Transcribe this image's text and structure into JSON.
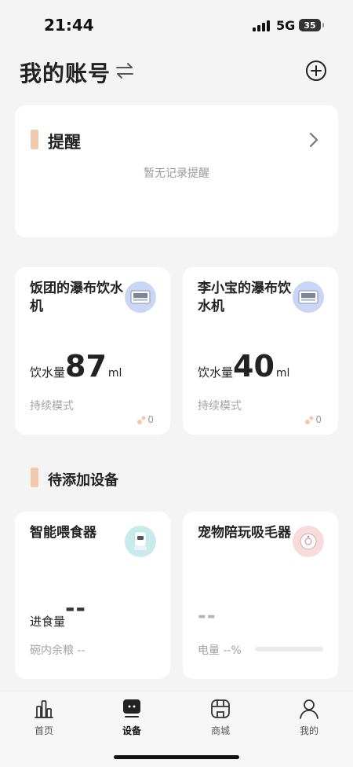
{
  "status_bar": {
    "time": "21:44",
    "network": "5G",
    "battery": "35"
  },
  "header": {
    "title": "我的账号"
  },
  "reminder": {
    "title": "提醒",
    "empty_text": "暂无记录提醒"
  },
  "devices": [
    {
      "name": "饭团的瀑布饮水机",
      "metric_label": "饮水量",
      "value": "87",
      "unit": "ml",
      "mode": "持续模式",
      "count": "0"
    },
    {
      "name": "李小宝的瀑布饮水机",
      "metric_label": "饮水量",
      "value": "40",
      "unit": "ml",
      "mode": "持续模式",
      "count": "0"
    }
  ],
  "pending": {
    "title": "待添加设备",
    "items": [
      {
        "name": "智能喂食器",
        "metric_label": "进食量",
        "value": "--",
        "bowl_label": "碗内余粮 --"
      },
      {
        "name": "宠物陪玩吸毛器",
        "value": "--",
        "power_label": "电量 --%"
      }
    ]
  },
  "nav": {
    "items": [
      {
        "label": "首页",
        "icon": "chart-icon"
      },
      {
        "label": "设备",
        "icon": "device-icon",
        "active": true
      },
      {
        "label": "商城",
        "icon": "store-icon"
      },
      {
        "label": "我的",
        "icon": "person-icon"
      }
    ]
  },
  "colors": {
    "accent": "#f2c9ad",
    "background": "#f4f4f5",
    "card": "#ffffff",
    "muted_text": "#a3a3a3"
  }
}
